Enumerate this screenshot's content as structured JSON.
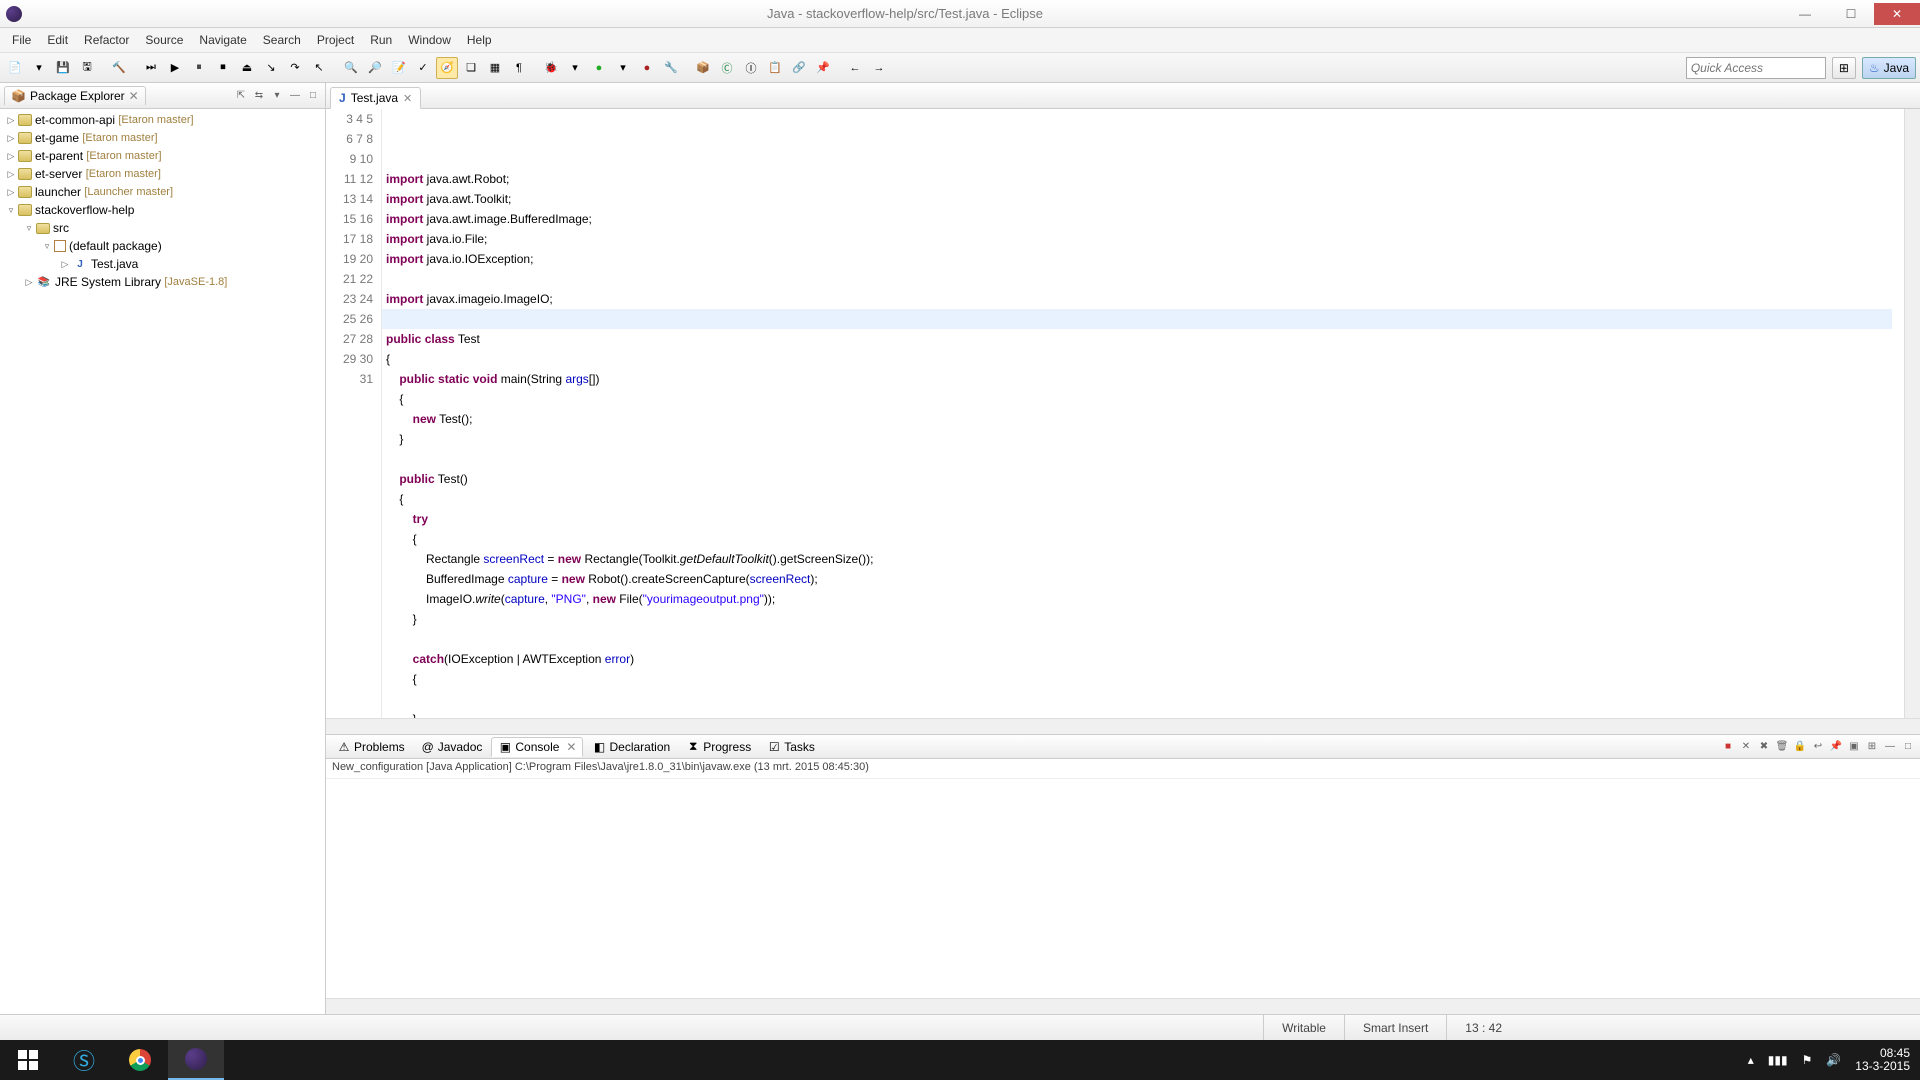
{
  "window": {
    "title": "Java - stackoverflow-help/src/Test.java - Eclipse"
  },
  "menu": {
    "file": "File",
    "edit": "Edit",
    "refactor": "Refactor",
    "source": "Source",
    "navigate": "Navigate",
    "search": "Search",
    "project": "Project",
    "run": "Run",
    "window": "Window",
    "help": "Help"
  },
  "quickaccess": {
    "placeholder": "Quick Access"
  },
  "perspective": {
    "java": "Java"
  },
  "package_explorer": {
    "title": "Package Explorer",
    "projects": [
      {
        "name": "et-common-api",
        "branch": "[Etaron master]"
      },
      {
        "name": "et-game",
        "branch": "[Etaron master]"
      },
      {
        "name": "et-parent",
        "branch": "[Etaron master]"
      },
      {
        "name": "et-server",
        "branch": "[Etaron master]"
      },
      {
        "name": "launcher",
        "branch": "[Launcher master]"
      }
    ],
    "open_project": {
      "name": "stackoverflow-help"
    },
    "src": "src",
    "default_pkg": "(default package)",
    "file": "Test.java",
    "jre": "JRE System Library",
    "jre_ver": "[JavaSE-1.8]"
  },
  "editor": {
    "tab": "Test.java",
    "lines": {
      "start": 3,
      "end": 31,
      "l3": {
        "kw": "import",
        "rest": " java.awt.Robot;"
      },
      "l4": {
        "kw": "import",
        "rest": " java.awt.Toolkit;"
      },
      "l5": {
        "kw": "import",
        "rest": " java.awt.image.BufferedImage;"
      },
      "l6": {
        "kw": "import",
        "rest": " java.io.File;"
      },
      "l7": {
        "kw": "import",
        "rest": " java.io.IOException;"
      },
      "l9": {
        "kw": "import",
        "rest": " javax.imageio.ImageIO;"
      },
      "l11": {
        "a": "public",
        "b": "class",
        "c": " Test"
      },
      "l12": "{",
      "l13": {
        "a": "public",
        "b": "static",
        "c": "void",
        "d": " main(String ",
        "e": "args",
        "f": "[])"
      },
      "l14": "    {",
      "l15": {
        "a": "new",
        "b": " Test();"
      },
      "l16": "    }",
      "l18": {
        "a": "public",
        "b": " Test()"
      },
      "l19": "    {",
      "l20": {
        "a": "try"
      },
      "l21": "        {",
      "l22": {
        "pre": "            Rectangle ",
        "var": "screenRect",
        "mid": " = ",
        "kw": "new",
        "post": " Rectangle(Toolkit.",
        "ital": "getDefaultToolkit",
        "post2": "().getScreenSize());"
      },
      "l23": {
        "pre": "            BufferedImage ",
        "var": "capture",
        "mid": " = ",
        "kw": "new",
        "post": " Robot().createScreenCapture(",
        "var2": "screenRect",
        "post2": ");"
      },
      "l24": {
        "pre": "            ImageIO.",
        "ital": "write",
        "mid": "(",
        "var": "capture",
        "c": ", ",
        "str": "\"PNG\"",
        "c2": ", ",
        "kw": "new",
        "post": " File(",
        "str2": "\"yourimageoutput.png\"",
        "post2": "));"
      },
      "l25": "        }",
      "l27": {
        "a": "catch",
        "b": "(IOException | AWTException ",
        "c": "error",
        "d": ")"
      },
      "l28": "        {",
      "l30": "        }",
      "l31": "    }"
    }
  },
  "bottom_tabs": {
    "problems": "Problems",
    "javadoc": "Javadoc",
    "console": "Console",
    "declaration": "Declaration",
    "progress": "Progress",
    "tasks": "Tasks"
  },
  "console": {
    "header": "New_configuration [Java Application] C:\\Program Files\\Java\\jre1.8.0_31\\bin\\javaw.exe (13 mrt. 2015 08:45:30)"
  },
  "status": {
    "writable": "Writable",
    "insert": "Smart Insert",
    "pos": "13 : 42"
  },
  "tray": {
    "time": "08:45",
    "date": "13-3-2015"
  }
}
